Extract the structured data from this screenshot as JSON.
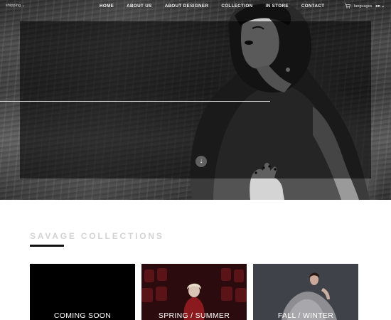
{
  "topbar": {
    "shipping_label": "shipping ⌄",
    "nav": [
      "HOME",
      "ABOUT US",
      "ABOUT DESIGNER",
      "COLLECTION",
      "IN STORE",
      "CONTACT"
    ],
    "languages_label": "languages",
    "current_language": "en ⌄",
    "cart_icon": "cart-icon"
  },
  "hero": {
    "scroll_icon": "arrow-down-icon",
    "scroll_glyph": "↓"
  },
  "collections": {
    "title": "SAVAGE COLLECTIONS",
    "cards": [
      {
        "label": "COMING SOON"
      },
      {
        "label": "SPRING / SUMMER"
      },
      {
        "label": "FALL / WINTER"
      }
    ]
  },
  "colors": {
    "nav_text": "#f2f2f2",
    "title_text": "#d3d3d3",
    "accent_rule": "#111111"
  }
}
